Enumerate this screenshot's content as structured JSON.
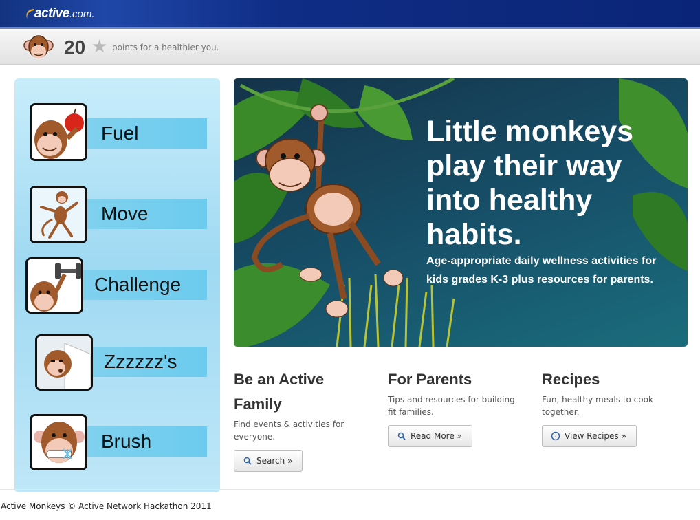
{
  "header": {
    "logo_text": "active",
    "logo_domain": ".com."
  },
  "points": {
    "value": "20",
    "star_icon": "star-icon",
    "label": "points for a healthier you."
  },
  "sidebar": {
    "items": [
      {
        "label": "Fuel",
        "icon": "monkey-apple-icon"
      },
      {
        "label": "Move",
        "icon": "monkey-jump-icon"
      },
      {
        "label": "Challenge",
        "icon": "monkey-dumbbell-icon"
      },
      {
        "label": "Zzzzzz's",
        "icon": "monkey-sleep-icon"
      },
      {
        "label": "Brush",
        "icon": "monkey-toothbrush-icon"
      }
    ]
  },
  "hero": {
    "title": "Little monkeys play their way into healthy habits.",
    "subtitle": "Age-appropriate daily wellness activities for kids grades K-3 plus resources for parents."
  },
  "columns": [
    {
      "title": "Be an Active Family",
      "text": "Find events & activities for everyone.",
      "button": "Search »",
      "icon": "search-icon"
    },
    {
      "title": "For Parents",
      "text": "Tips and resources for building fit families.",
      "button": "Read More »",
      "icon": "search-icon"
    },
    {
      "title": "Recipes",
      "text": "Fun, healthy meals to cook together.",
      "button": "View Recipes »",
      "icon": "compass-icon"
    }
  ],
  "footer": {
    "text": "Active Monkeys © Active Network Hackathon 2011"
  },
  "colors": {
    "topbar": "#13337f",
    "sidebar": "#9fd9f2",
    "label_bar": "#6ccbee",
    "hero_bg": "#17516a"
  }
}
